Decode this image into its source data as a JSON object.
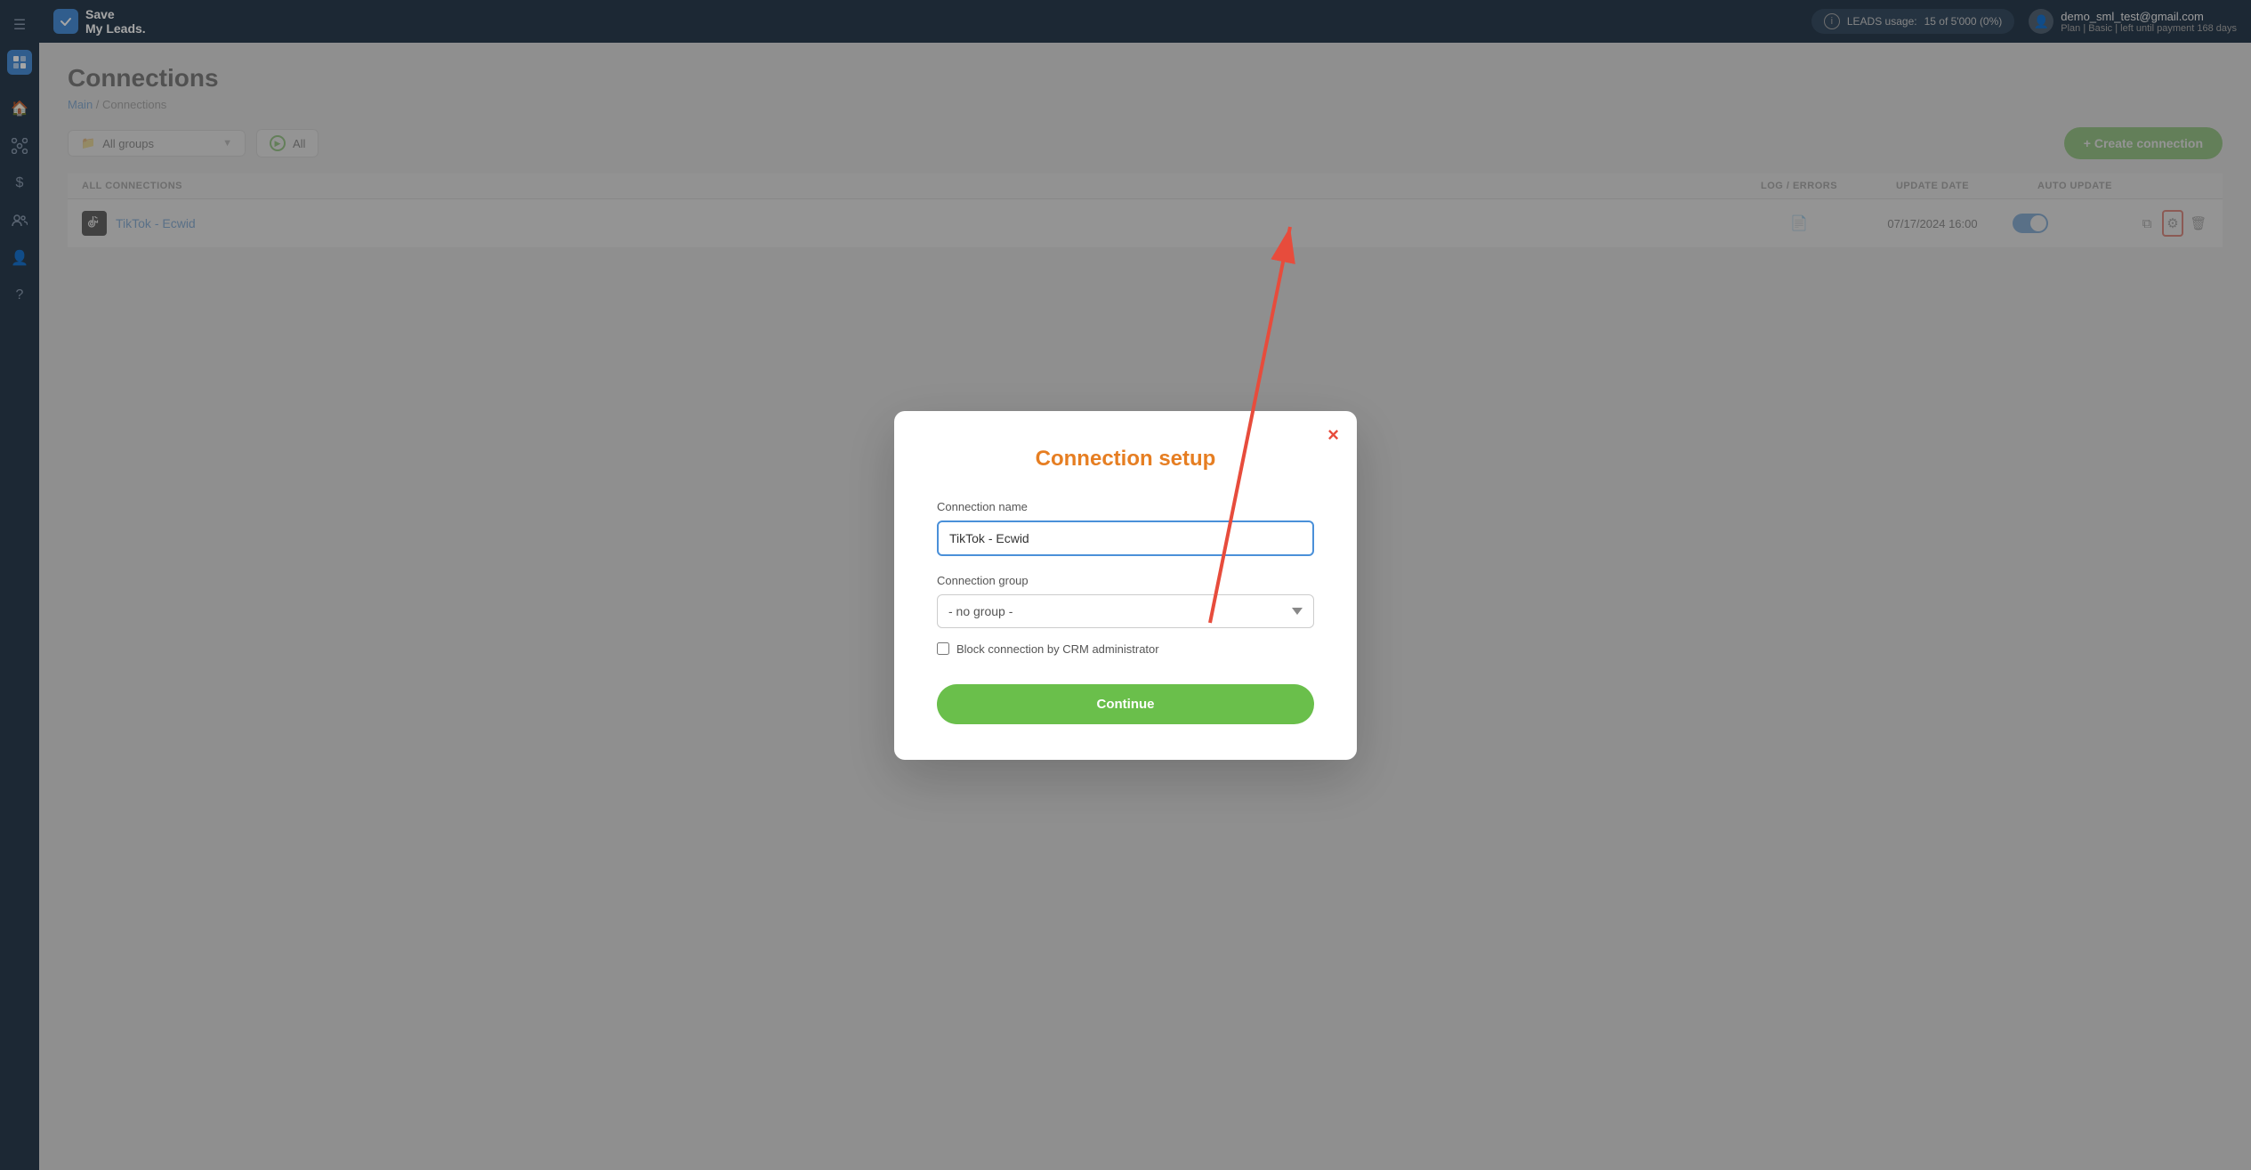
{
  "app": {
    "name": "Save",
    "name2": "My Leads.",
    "hamburger_label": "☰"
  },
  "topbar": {
    "leads_label": "LEADS usage:",
    "leads_value": "15 of 5'000 (0%)",
    "user_email": "demo_sml_test@gmail.com",
    "user_plan": "Plan | Basic | left until payment 168 days",
    "info_icon": "ℹ",
    "user_icon": "👤"
  },
  "sidebar": {
    "icons": [
      "☰",
      "🏠",
      "⚙",
      "$",
      "👥",
      "👤",
      "?"
    ]
  },
  "page": {
    "title": "Connections",
    "breadcrumb_main": "Main",
    "breadcrumb_sep": " / ",
    "breadcrumb_current": "Connections"
  },
  "toolbar": {
    "group_label": "All groups",
    "filter_label": "All",
    "create_btn": "+ Create connection"
  },
  "table": {
    "headers": {
      "all_connections": "ALL CONNECTIONS",
      "log_errors": "LOG / ERRORS",
      "update_date": "UPDATE DATE",
      "auto_update": "AUTO UPDATE"
    },
    "rows": [
      {
        "name": "TikTok - Ecwid",
        "logo": "T",
        "update_date": "07/17/2024 16:00",
        "auto_update": true
      }
    ]
  },
  "modal": {
    "title": "Connection setup",
    "close_label": "×",
    "connection_name_label": "Connection name",
    "connection_name_value": "TikTok - Ecwid",
    "connection_group_label": "Connection group",
    "group_option": "- no group -",
    "checkbox_label": "Block connection by CRM administrator",
    "continue_btn": "Continue"
  },
  "arrow": {
    "color": "#e74c3c"
  }
}
